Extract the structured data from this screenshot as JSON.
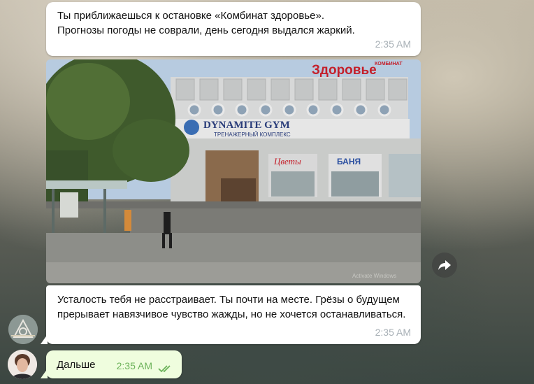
{
  "messages": [
    {
      "text": "Ты приближаешься к остановке «Комбинат здоровье».\nПрогнозы погоды не соврали, день сегодня выдался жаркий.",
      "time": "2:35 AM"
    },
    {
      "text": "Усталость тебя не расстраивает. Ты почти на месте. Грёзы о будущем прерывает навязчивое чувство жажды, но не хочется останавливаться.",
      "time": "2:35 AM"
    },
    {
      "text": "Дальше",
      "time": "2:35 AM",
      "status": "read"
    }
  ],
  "photo": {
    "sign_top_small": "КОМБИНАТ",
    "sign_top": "Здоровье",
    "banner": "DYNAMITE GYM",
    "banner_sub": "ТРЕНАЖЕРНЫЙ КОМПЛЕКС",
    "shop1": "Цветы",
    "shop2": "БАНЯ",
    "watermark": "Activate Windows"
  },
  "icons": {
    "forward": "forward-arrow-icon",
    "read_status": "double-check-icon"
  },
  "colors": {
    "incoming_bubble": "#ffffff",
    "outgoing_bubble": "#effdde",
    "time_gray": "#a8b0b6",
    "time_green": "#6cb35a"
  }
}
